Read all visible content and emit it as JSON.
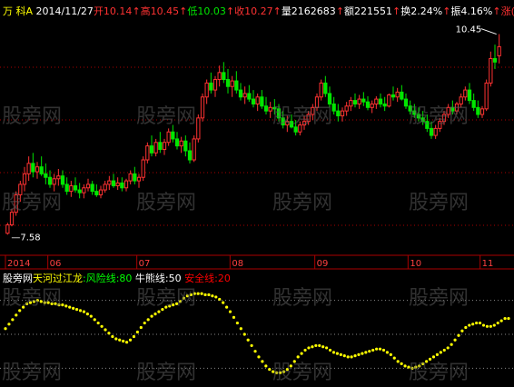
{
  "window": {
    "title": "万 科A"
  },
  "colors": {
    "up": "#ff3232",
    "down": "#00e600",
    "text": "#ffffff",
    "yellow": "#ffff00",
    "green": "#00ff00",
    "red": "#ff0000",
    "grid": "#aa0000",
    "axis": "#aa0000"
  },
  "header": {
    "title": "万 科A",
    "items": [
      {
        "text": "2014/11/27",
        "color": "#ffffff"
      },
      {
        "text": "开10.14",
        "color": "#ff3232"
      },
      {
        "text": "↑",
        "color": "#ff3232"
      },
      {
        "text": "高10.45",
        "color": "#ff3232"
      },
      {
        "text": "↑",
        "color": "#ff3232"
      },
      {
        "text": "低10.03",
        "color": "#00e600"
      },
      {
        "text": "↑",
        "color": "#ff3232"
      },
      {
        "text": "收10.27",
        "color": "#ff3232"
      },
      {
        "text": "↑",
        "color": "#ff3232"
      },
      {
        "text": "量2162683",
        "color": "#ffffff"
      },
      {
        "text": "↑",
        "color": "#ff3232"
      },
      {
        "text": "额221551",
        "color": "#ffffff"
      },
      {
        "text": "↑",
        "color": "#ff3232"
      },
      {
        "text": "换2.24%",
        "color": "#ffffff"
      },
      {
        "text": "↑",
        "color": "#ff3232"
      },
      {
        "text": "振4.16%",
        "color": "#ffffff"
      },
      {
        "text": "↑",
        "color": "#ff3232"
      },
      {
        "text": "涨(0.17)",
        "color": "#ff3232"
      },
      {
        "text": "↑",
        "color": "#ff3232"
      }
    ]
  },
  "x_axis_labels": [
    "2014",
    "06",
    "07",
    "08",
    "09",
    "10",
    "11"
  ],
  "indicator": {
    "labels": [
      {
        "text": "股旁网",
        "color": "#ffffff"
      },
      {
        "text": "天河过江龙",
        "color": "#ffff00"
      },
      {
        "text": ":风险线:80",
        "color": "#00ff00"
      },
      {
        "text": " 牛熊线:50",
        "color": "#ffffff"
      },
      {
        "text": " 安全线:20",
        "color": "#ff0000"
      }
    ],
    "levels": {
      "risk": 80,
      "bull_bear": 50,
      "safe": 20
    }
  },
  "watermark": "股旁网",
  "chart_data": [
    {
      "type": "candlestick",
      "title": "万 科A",
      "max_label": "10.45",
      "min_label": "7.58",
      "ylim": [
        7.35,
        10.6
      ],
      "x_ticks": [
        {
          "label": "2014",
          "index": 0
        },
        {
          "label": "06",
          "index": 10
        },
        {
          "label": "07",
          "index": 31
        },
        {
          "label": "08",
          "index": 53
        },
        {
          "label": "09",
          "index": 73
        },
        {
          "label": "10",
          "index": 95
        },
        {
          "label": "11",
          "index": 112
        }
      ],
      "candles": [
        [
          7.6,
          7.75,
          7.58,
          7.72
        ],
        [
          7.72,
          7.95,
          7.7,
          7.9
        ],
        [
          7.9,
          8.2,
          7.85,
          8.15
        ],
        [
          8.15,
          8.35,
          8.05,
          8.3
        ],
        [
          8.3,
          8.55,
          8.2,
          8.45
        ],
        [
          8.45,
          8.7,
          8.35,
          8.6
        ],
        [
          8.6,
          8.75,
          8.4,
          8.48
        ],
        [
          8.48,
          8.62,
          8.38,
          8.55
        ],
        [
          8.55,
          8.7,
          8.42,
          8.45
        ],
        [
          8.45,
          8.6,
          8.3,
          8.4
        ],
        [
          8.4,
          8.5,
          8.25,
          8.3
        ],
        [
          8.3,
          8.45,
          8.2,
          8.38
        ],
        [
          8.38,
          8.52,
          8.28,
          8.42
        ],
        [
          8.42,
          8.5,
          8.25,
          8.3
        ],
        [
          8.3,
          8.4,
          8.15,
          8.2
        ],
        [
          8.2,
          8.35,
          8.12,
          8.28
        ],
        [
          8.28,
          8.4,
          8.18,
          8.22
        ],
        [
          8.22,
          8.32,
          8.1,
          8.18
        ],
        [
          8.18,
          8.3,
          8.1,
          8.25
        ],
        [
          8.25,
          8.38,
          8.2,
          8.3
        ],
        [
          8.3,
          8.35,
          8.15,
          8.2
        ],
        [
          8.2,
          8.3,
          8.12,
          8.15
        ],
        [
          8.15,
          8.28,
          8.1,
          8.22
        ],
        [
          8.22,
          8.35,
          8.18,
          8.3
        ],
        [
          8.3,
          8.42,
          8.22,
          8.35
        ],
        [
          8.35,
          8.45,
          8.25,
          8.28
        ],
        [
          8.28,
          8.4,
          8.22,
          8.32
        ],
        [
          8.32,
          8.4,
          8.2,
          8.25
        ],
        [
          8.25,
          8.38,
          8.2,
          8.35
        ],
        [
          8.35,
          8.5,
          8.3,
          8.45
        ],
        [
          8.45,
          8.55,
          8.3,
          8.35
        ],
        [
          8.35,
          8.45,
          8.25,
          8.4
        ],
        [
          8.4,
          8.7,
          8.35,
          8.65
        ],
        [
          8.65,
          8.9,
          8.6,
          8.85
        ],
        [
          8.85,
          9.0,
          8.7,
          8.75
        ],
        [
          8.75,
          8.95,
          8.7,
          8.9
        ],
        [
          8.9,
          9.05,
          8.75,
          8.8
        ],
        [
          8.8,
          8.95,
          8.72,
          8.9
        ],
        [
          8.9,
          9.1,
          8.85,
          9.05
        ],
        [
          9.05,
          9.15,
          8.9,
          8.95
        ],
        [
          8.95,
          9.05,
          8.8,
          8.85
        ],
        [
          8.85,
          8.98,
          8.75,
          8.92
        ],
        [
          8.92,
          9.0,
          8.7,
          8.78
        ],
        [
          8.78,
          8.9,
          8.6,
          8.65
        ],
        [
          8.65,
          9.0,
          8.62,
          8.95
        ],
        [
          8.95,
          9.3,
          8.9,
          9.25
        ],
        [
          9.25,
          9.6,
          9.2,
          9.55
        ],
        [
          9.55,
          9.8,
          9.45,
          9.75
        ],
        [
          9.75,
          9.9,
          9.6,
          9.65
        ],
        [
          9.65,
          9.85,
          9.55,
          9.8
        ],
        [
          9.8,
          10.0,
          9.7,
          9.9
        ],
        [
          9.9,
          10.05,
          9.75,
          9.8
        ],
        [
          9.8,
          9.95,
          9.6,
          9.7
        ],
        [
          9.7,
          9.85,
          9.55,
          9.78
        ],
        [
          9.78,
          9.92,
          9.6,
          9.65
        ],
        [
          9.65,
          9.75,
          9.5,
          9.55
        ],
        [
          9.55,
          9.7,
          9.45,
          9.6
        ],
        [
          9.6,
          9.72,
          9.48,
          9.52
        ],
        [
          9.52,
          9.65,
          9.4,
          9.45
        ],
        [
          9.45,
          9.6,
          9.35,
          9.55
        ],
        [
          9.55,
          9.65,
          9.38,
          9.42
        ],
        [
          9.42,
          9.55,
          9.3,
          9.35
        ],
        [
          9.35,
          9.48,
          9.25,
          9.4
        ],
        [
          9.4,
          9.52,
          9.3,
          9.38
        ],
        [
          9.38,
          9.45,
          9.2,
          9.25
        ],
        [
          9.25,
          9.35,
          9.1,
          9.15
        ],
        [
          9.15,
          9.28,
          9.05,
          9.2
        ],
        [
          9.2,
          9.3,
          9.1,
          9.12
        ],
        [
          9.12,
          9.22,
          9.0,
          9.05
        ],
        [
          9.05,
          9.2,
          9.0,
          9.15
        ],
        [
          9.15,
          9.28,
          9.08,
          9.2
        ],
        [
          9.2,
          9.35,
          9.15,
          9.3
        ],
        [
          9.3,
          9.45,
          9.22,
          9.4
        ],
        [
          9.4,
          9.6,
          9.35,
          9.55
        ],
        [
          9.55,
          9.8,
          9.5,
          9.75
        ],
        [
          9.75,
          9.85,
          9.55,
          9.6
        ],
        [
          9.6,
          9.7,
          9.4,
          9.45
        ],
        [
          9.45,
          9.55,
          9.3,
          9.35
        ],
        [
          9.35,
          9.45,
          9.2,
          9.28
        ],
        [
          9.28,
          9.4,
          9.2,
          9.35
        ],
        [
          9.35,
          9.48,
          9.28,
          9.42
        ],
        [
          9.42,
          9.55,
          9.35,
          9.5
        ],
        [
          9.5,
          9.6,
          9.4,
          9.45
        ],
        [
          9.45,
          9.58,
          9.38,
          9.52
        ],
        [
          9.52,
          9.62,
          9.42,
          9.48
        ],
        [
          9.48,
          9.56,
          9.36,
          9.4
        ],
        [
          9.4,
          9.5,
          9.32,
          9.45
        ],
        [
          9.45,
          9.56,
          9.38,
          9.52
        ],
        [
          9.52,
          9.6,
          9.4,
          9.45
        ],
        [
          9.45,
          9.55,
          9.35,
          9.42
        ],
        [
          9.42,
          9.6,
          9.4,
          9.58
        ],
        [
          9.58,
          9.7,
          9.5,
          9.55
        ],
        [
          9.55,
          9.68,
          9.48,
          9.62
        ],
        [
          9.62,
          9.72,
          9.5,
          9.52
        ],
        [
          9.52,
          9.6,
          9.38,
          9.42
        ],
        [
          9.42,
          9.5,
          9.3,
          9.35
        ],
        [
          9.35,
          9.45,
          9.25,
          9.3
        ],
        [
          9.3,
          9.4,
          9.2,
          9.25
        ],
        [
          9.25,
          9.35,
          9.15,
          9.2
        ],
        [
          9.2,
          9.3,
          9.05,
          9.1
        ],
        [
          9.1,
          9.2,
          8.95,
          9.0
        ],
        [
          9.0,
          9.15,
          8.95,
          9.1
        ],
        [
          9.1,
          9.25,
          9.05,
          9.2
        ],
        [
          9.2,
          9.35,
          9.15,
          9.3
        ],
        [
          9.3,
          9.45,
          9.25,
          9.4
        ],
        [
          9.4,
          9.5,
          9.3,
          9.35
        ],
        [
          9.35,
          9.48,
          9.3,
          9.45
        ],
        [
          9.45,
          9.6,
          9.4,
          9.55
        ],
        [
          9.55,
          9.7,
          9.5,
          9.65
        ],
        [
          9.65,
          9.75,
          9.45,
          9.5
        ],
        [
          9.5,
          9.6,
          9.35,
          9.4
        ],
        [
          9.4,
          9.5,
          9.25,
          9.3
        ],
        [
          9.3,
          9.42,
          9.25,
          9.38
        ],
        [
          9.38,
          9.8,
          9.35,
          9.75
        ],
        [
          9.75,
          10.2,
          9.7,
          10.1
        ],
        [
          10.1,
          10.3,
          9.95,
          10.05
        ],
        [
          10.14,
          10.45,
          10.03,
          10.27
        ]
      ]
    },
    {
      "type": "scatter",
      "title": "天河过江龙",
      "ylim": [
        0,
        100
      ],
      "reference_lines": [
        {
          "name": "风险线",
          "value": 80
        },
        {
          "name": "牛熊线",
          "value": 50
        },
        {
          "name": "安全线",
          "value": 20
        }
      ],
      "series": [
        {
          "name": "天河过江龙",
          "values": [
            55,
            59,
            63,
            67,
            71,
            74,
            77,
            78,
            79,
            80,
            79,
            78,
            78,
            77,
            77,
            76,
            76,
            75,
            74,
            73,
            72,
            71,
            70,
            68,
            66,
            63,
            60,
            57,
            54,
            51,
            48,
            46,
            45,
            44,
            43,
            45,
            48,
            52,
            56,
            60,
            63,
            66,
            68,
            70,
            72,
            74,
            75,
            76,
            77,
            79,
            82,
            84,
            85,
            86,
            86,
            86,
            85,
            85,
            84,
            83,
            81,
            78,
            74,
            70,
            65,
            60,
            55,
            50,
            45,
            40,
            35,
            30,
            26,
            22,
            19,
            17,
            16,
            16,
            17,
            19,
            22,
            26,
            30,
            33,
            36,
            38,
            39,
            40,
            40,
            39,
            38,
            36,
            34,
            33,
            32,
            31,
            30,
            30,
            31,
            32,
            33,
            34,
            35,
            36,
            37,
            37,
            36,
            34,
            32,
            29,
            26,
            24,
            22,
            21,
            20,
            21,
            22,
            24,
            26,
            28,
            30,
            32,
            34,
            36,
            38,
            41,
            45,
            49,
            53,
            56,
            58,
            59,
            60,
            60,
            58,
            57,
            57,
            58,
            60,
            62,
            64,
            64
          ]
        }
      ]
    }
  ]
}
